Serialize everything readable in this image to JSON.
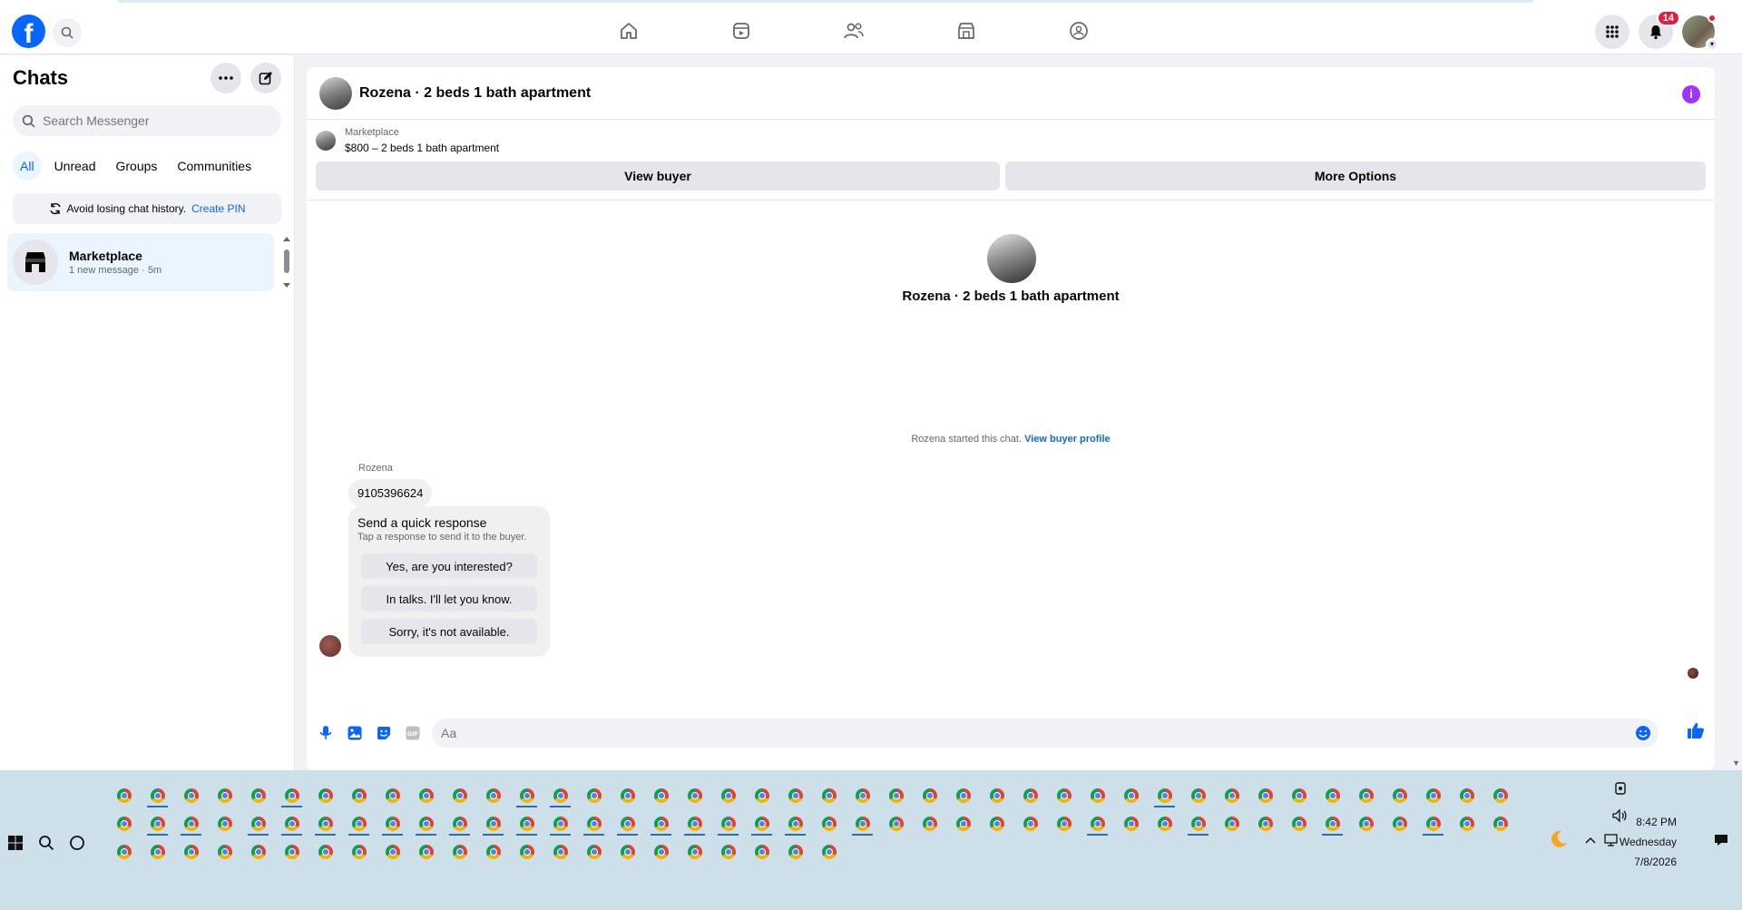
{
  "topbar": {
    "nav": [
      "home-icon",
      "video-icon",
      "friends-icon",
      "marketplace-icon",
      "groups-icon"
    ],
    "notifications_count": "14"
  },
  "sidebar": {
    "title": "Chats",
    "search_placeholder": "Search Messenger",
    "filters": [
      "All",
      "Unread",
      "Groups",
      "Communities"
    ],
    "pin_text": "Avoid losing chat history.",
    "pin_link": "Create PIN",
    "chats": [
      {
        "name": "Marketplace",
        "preview": "1 new message · 5m"
      }
    ]
  },
  "conversation": {
    "title": "Rozena · 2 beds 1 bath apartment",
    "listing_source": "Marketplace",
    "listing_price": "$800 – 2 beds 1 bath apartment",
    "view_buyer": "View buyer",
    "more_options": "More Options",
    "center_name": "Rozena · 2 beds 1 bath apartment",
    "started_text": "Rozena started this chat.",
    "started_link": "View buyer profile",
    "sender": "Rozena",
    "message": "9105396624",
    "quick_title": "Send a quick response",
    "quick_sub": "Tap a response to send it to the buyer.",
    "quick_responses": [
      "Yes, are you interested?",
      "In talks. I'll let you know.",
      "Sorry, it's not available."
    ],
    "composer_placeholder": "Aa"
  },
  "taskbar": {
    "time": "8:42 PM",
    "day": "Wednesday",
    "date": "7/8/2026"
  },
  "colors": {
    "accent": "#0866ff",
    "info": "#a033ff",
    "badge": "#e41e3f"
  }
}
